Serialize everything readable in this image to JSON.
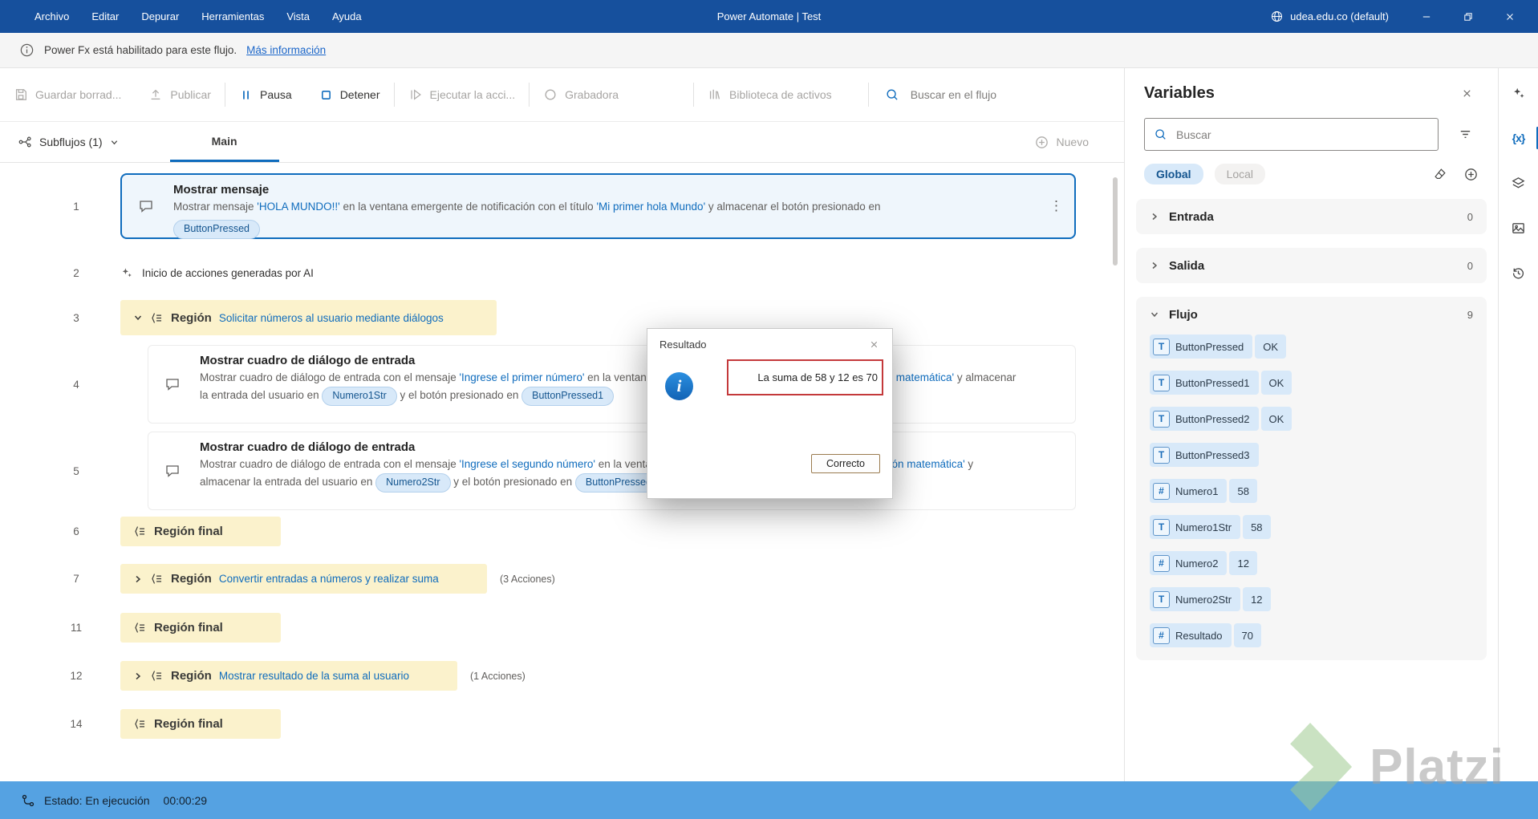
{
  "colors": {
    "accent": "#0f6cbd",
    "titlebar": "#16509d",
    "status_bar": "#55a2e2",
    "region_bg": "#fbf2cc",
    "error_border": "#c4393b",
    "pill_bg": "#d8e9f9"
  },
  "icons": {
    "dots_vertical": "⋮",
    "variables_x": "{x}",
    "info_i": "i"
  },
  "titlebar": {
    "menus": [
      "Archivo",
      "Editar",
      "Depurar",
      "Herramientas",
      "Vista",
      "Ayuda"
    ],
    "title": "Power Automate | Test",
    "account": "udea.edu.co (default)"
  },
  "infobar": {
    "text": "Power Fx está habilitado para este flujo.",
    "link": "Más información"
  },
  "toolbar": {
    "save": "Guardar borrad...",
    "publish": "Publicar",
    "pause": "Pausa",
    "stop": "Detener",
    "run_action": "Ejecutar la acci...",
    "recorder": "Grabadora",
    "assets": "Biblioteca de activos",
    "search_placeholder": "Buscar en el flujo"
  },
  "tabbar": {
    "subflows": "Subflujos (1)",
    "main": "Main",
    "new": "Nuevo"
  },
  "canvas": {
    "r1": {
      "num": "1",
      "title": "Mostrar mensaje",
      "d1": "Mostrar mensaje ",
      "q1": "'HOLA MUNDO!!'",
      "d2": " en la ventana emergente de notificación con el título ",
      "q2": "'Mi primer hola Mundo'",
      "d3": " y almacenar el botón presionado en",
      "pill": "ButtonPressed"
    },
    "r2": {
      "num": "2",
      "text": "Inicio de acciones generadas por AI"
    },
    "r3": {
      "num": "3",
      "label": "Región",
      "link": "Solicitar números al usuario mediante diálogos"
    },
    "r4": {
      "num": "4",
      "title": "Mostrar cuadro de diálogo de entrada",
      "d1": "Mostrar cuadro de diálogo de entrada con el mensaje ",
      "q1": "'Ingrese el primer número'",
      "d2": " en la ventana emergente de notificación con el título ",
      "q2": "'Operación matemática'",
      "d3": " y almacenar la entrada del usuario en ",
      "pill1": "Numero1Str",
      "d4": " y el botón presionado en ",
      "pill2": "ButtonPressed1"
    },
    "r5": {
      "num": "5",
      "title": "Mostrar cuadro de diálogo de entrada",
      "d1": "Mostrar cuadro de diálogo de entrada con el mensaje ",
      "q1": "'Ingrese el segundo número'",
      "d2": " en la ventana emergente de notificación con el título ",
      "q2": "'Operación matemática'",
      "d3": " y almacenar la entrada del usuario en ",
      "pill1": "Numero2Str",
      "d4": " y el botón presionado en ",
      "pill2": "ButtonPressed2"
    },
    "r6": {
      "num": "6",
      "label": "Región final"
    },
    "r7": {
      "num": "7",
      "label": "Región",
      "link": "Convertir entradas a números y realizar suma",
      "note": "(3 Acciones)"
    },
    "r11": {
      "num": "11",
      "label": "Región final"
    },
    "r12": {
      "num": "12",
      "label": "Región",
      "link": "Mostrar resultado de la suma al usuario",
      "note": "(1 Acciones)"
    },
    "r14": {
      "num": "14",
      "label": "Región final"
    }
  },
  "dialog": {
    "title": "Resultado",
    "message": "La suma de 58 y 12 es 70",
    "ok": "Correcto"
  },
  "variables": {
    "title": "Variables",
    "search_placeholder": "Buscar",
    "tab_global": "Global",
    "tab_local": "Local",
    "sections": {
      "entrada": {
        "name": "Entrada",
        "count": "0"
      },
      "salida": {
        "name": "Salida",
        "count": "0"
      },
      "flujo": {
        "name": "Flujo",
        "count": "9"
      }
    },
    "flow_vars": [
      {
        "name": "ButtonPressed",
        "type": "T",
        "value": "OK"
      },
      {
        "name": "ButtonPressed1",
        "type": "T",
        "value": "OK"
      },
      {
        "name": "ButtonPressed2",
        "type": "T",
        "value": "OK"
      },
      {
        "name": "ButtonPressed3",
        "type": "T",
        "value": ""
      },
      {
        "name": "Numero1",
        "type": "#",
        "value": "58"
      },
      {
        "name": "Numero1Str",
        "type": "T",
        "value": "58"
      },
      {
        "name": "Numero2",
        "type": "#",
        "value": "12"
      },
      {
        "name": "Numero2Str",
        "type": "T",
        "value": "12"
      },
      {
        "name": "Resultado",
        "type": "#",
        "value": "70"
      }
    ]
  },
  "statusbar": {
    "text": "Estado: En ejecución",
    "time": "00:00:29"
  },
  "watermark": {
    "text": "Platzi"
  }
}
